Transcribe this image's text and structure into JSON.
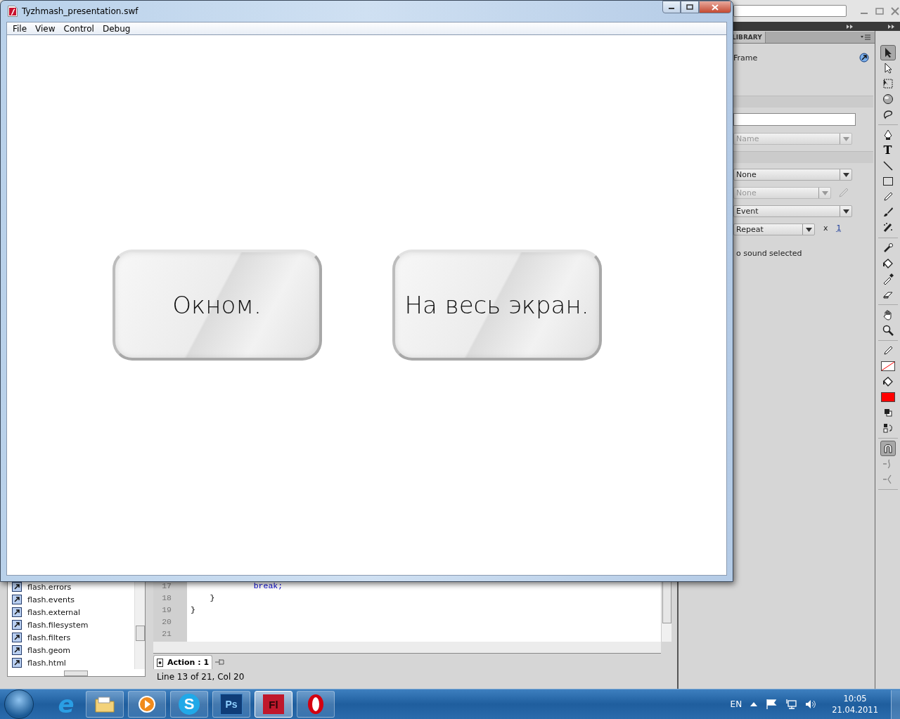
{
  "ide": {
    "library_tab": "LIBRARY",
    "frame_label": "Frame",
    "properties": [
      {
        "kind": "input"
      },
      {
        "kind": "dropdown",
        "value": "Name",
        "disabled": true
      },
      {
        "kind": "section"
      },
      {
        "kind": "dropdown",
        "value": "None",
        "disabled": false
      },
      {
        "kind": "dropdown-edit",
        "value": "None",
        "disabled": true
      },
      {
        "kind": "dropdown",
        "value": "Event",
        "disabled": false
      },
      {
        "kind": "repeat",
        "value": "Repeat",
        "disabled": false,
        "times_label": "x",
        "times": "1"
      },
      {
        "kind": "note",
        "text": "o sound selected"
      }
    ],
    "tool_groups": [
      {
        "tools": [
          {
            "kind": "selection",
            "selected": true
          },
          {
            "kind": "subselection",
            "selected": false
          },
          {
            "kind": "free-transform",
            "selected": false
          },
          {
            "kind": "rotate-3d",
            "selected": false
          },
          {
            "kind": "lasso",
            "selected": false
          }
        ]
      },
      {
        "tools": [
          {
            "kind": "pen",
            "selected": false
          },
          {
            "kind": "text",
            "label": "T",
            "selected": false
          },
          {
            "kind": "line",
            "selected": false
          },
          {
            "kind": "rectangle",
            "selected": false
          },
          {
            "kind": "pencil",
            "selected": false
          },
          {
            "kind": "brush",
            "selected": false
          },
          {
            "kind": "deco",
            "selected": false
          }
        ]
      },
      {
        "tools": [
          {
            "kind": "bone",
            "selected": false
          },
          {
            "kind": "bucket",
            "selected": false
          },
          {
            "kind": "eyedropper",
            "selected": false
          },
          {
            "kind": "eraser",
            "selected": false
          }
        ]
      },
      {
        "tools": [
          {
            "kind": "hand",
            "selected": false
          },
          {
            "kind": "zoom",
            "selected": false
          }
        ]
      },
      {
        "tools": [
          {
            "kind": "stroke-pencil",
            "selected": false
          },
          {
            "kind": "stroke-swatch",
            "selected": false
          },
          {
            "kind": "fill-bucket",
            "selected": false
          },
          {
            "kind": "fill-swatch",
            "selected": false
          },
          {
            "kind": "default-colors",
            "selected": false
          },
          {
            "kind": "swap-colors",
            "selected": false
          }
        ]
      },
      {
        "tools": [
          {
            "kind": "snap",
            "selected": true
          },
          {
            "kind": "smooth",
            "selected": false
          },
          {
            "kind": "straighten",
            "selected": false
          }
        ]
      }
    ],
    "packages": [
      "flash.errors",
      "flash.events",
      "flash.external",
      "flash.filesystem",
      "flash.filters",
      "flash.geom",
      "flash.html"
    ],
    "code_lines": [
      {
        "num": "17",
        "code": "             break;",
        "kind": "keyword"
      },
      {
        "num": "18",
        "code": "    }",
        "kind": "plain"
      },
      {
        "num": "19",
        "code": "}",
        "kind": "plain"
      },
      {
        "num": "20"
      },
      {
        "num": "21"
      }
    ],
    "script_tab": "Action : 1",
    "status": "Line 13 of 21, Col 20"
  },
  "player": {
    "title": "Tyzhmash_presentation.swf",
    "menu": [
      "File",
      "View",
      "Control",
      "Debug"
    ],
    "buttons": [
      "Окном.",
      "На весь экран."
    ]
  },
  "taskbar": {
    "apps": [
      {
        "kind": "ie",
        "label": "e",
        "selected": false
      },
      {
        "kind": "explorer",
        "selected": false
      },
      {
        "kind": "media",
        "selected": false
      },
      {
        "kind": "skype",
        "label": "S",
        "selected": false
      },
      {
        "kind": "photoshop",
        "label": "Ps",
        "selected": false
      },
      {
        "kind": "flash",
        "label": "Fl",
        "selected": true
      },
      {
        "kind": "opera",
        "selected": false
      }
    ],
    "language": "EN",
    "time": "10:05",
    "date": "21.04.2011"
  }
}
